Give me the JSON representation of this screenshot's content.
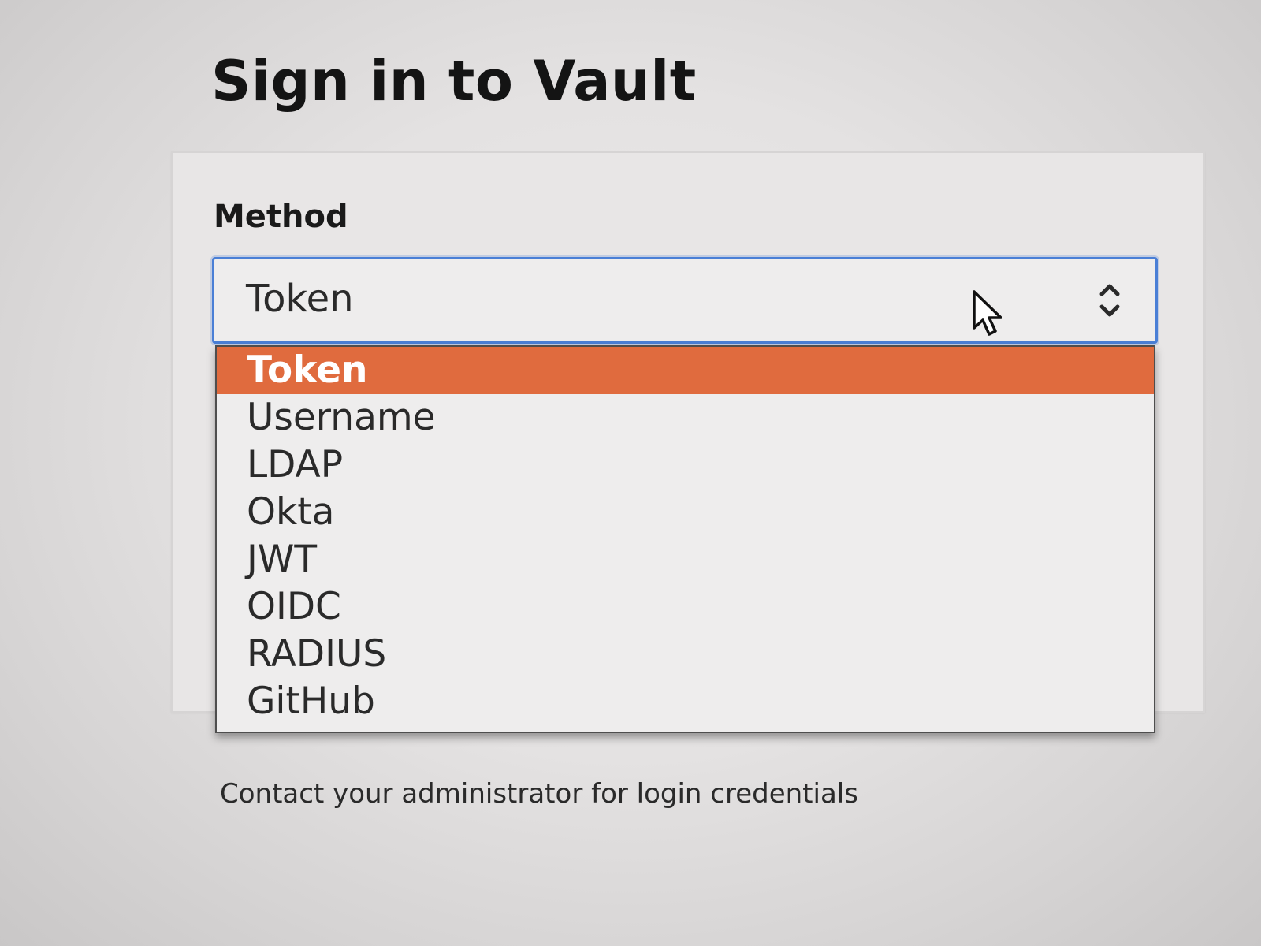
{
  "page": {
    "title": "Sign in to Vault",
    "help_text": "Contact your administrator for login credentials"
  },
  "method": {
    "label": "Method",
    "selected_value": "Token",
    "options": [
      "Token",
      "Username",
      "LDAP",
      "Okta",
      "JWT",
      "OIDC",
      "RADIUS",
      "GitHub"
    ],
    "highlighted_option": "Token"
  },
  "colors": {
    "highlight": "#e06b3e",
    "focus_border": "#4a7fd6"
  },
  "icons": {
    "select_chevron": "chevron-up-down-icon",
    "pointer": "mouse-cursor-icon"
  }
}
